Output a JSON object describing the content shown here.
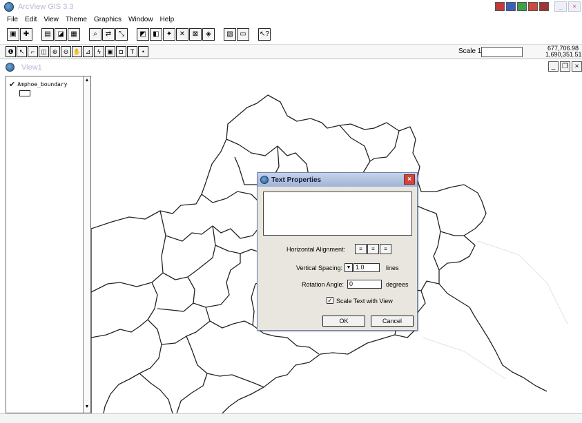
{
  "app": {
    "title": "ArcView GIS 3.3",
    "close_glyph": "×",
    "minimize_glyph": "_"
  },
  "menu": [
    "File",
    "Edit",
    "View",
    "Theme",
    "Graphics",
    "Window",
    "Help"
  ],
  "toolbar": {
    "scale_label": "Scale 1:",
    "scale_value": "",
    "coord_x": "677,706.98",
    "coord_y": "1,690,351.51"
  },
  "view": {
    "title": "View1",
    "min": "_",
    "restore": "❐",
    "close": "×"
  },
  "toc": {
    "layers": [
      {
        "name": "Amphoe_boundary",
        "visible": true
      }
    ]
  },
  "dialog": {
    "title": "Text Properties",
    "close": "×",
    "text_value": "",
    "horizontal_alignment_label": "Horizontal Alignment:",
    "vertical_spacing_label": "Vertical Spacing:",
    "vertical_spacing_value": "1.0",
    "lines_label": "lines",
    "rotation_angle_label": "Rotation Angle:",
    "rotation_angle_value": "0",
    "degrees_label": "degrees",
    "scale_text_label": "Scale Text with View",
    "scale_text_checked": true,
    "ok_label": "OK",
    "cancel_label": "Cancel"
  }
}
